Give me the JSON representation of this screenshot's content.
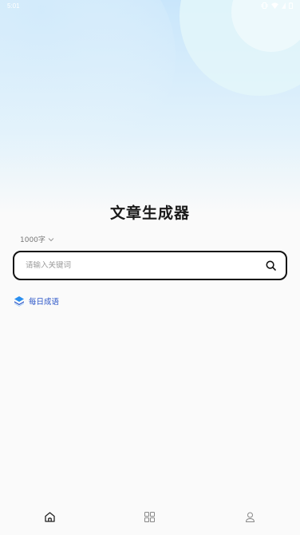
{
  "status_bar": {
    "time": "5:01",
    "icons": [
      "vibrate-icon",
      "wifi-icon",
      "battery-icon"
    ]
  },
  "page": {
    "title": "文章生成器"
  },
  "word_count": {
    "value": "1000字",
    "icon": "chevron-down-icon"
  },
  "search": {
    "placeholder": "请输入关键词",
    "value": "",
    "icon": "search-icon"
  },
  "daily_idiom": {
    "label": "每日成语",
    "icon": "layers-icon"
  },
  "bottom_nav": {
    "items": [
      {
        "name": "home",
        "icon": "home-icon",
        "active": true
      },
      {
        "name": "grid",
        "icon": "grid-icon",
        "active": false
      },
      {
        "name": "profile",
        "icon": "user-icon",
        "active": false
      }
    ]
  },
  "colors": {
    "accent": "#2b55c8",
    "search_border": "#111111",
    "background": "#fafafa",
    "bg_gradient_top": "#c7e6fb"
  }
}
